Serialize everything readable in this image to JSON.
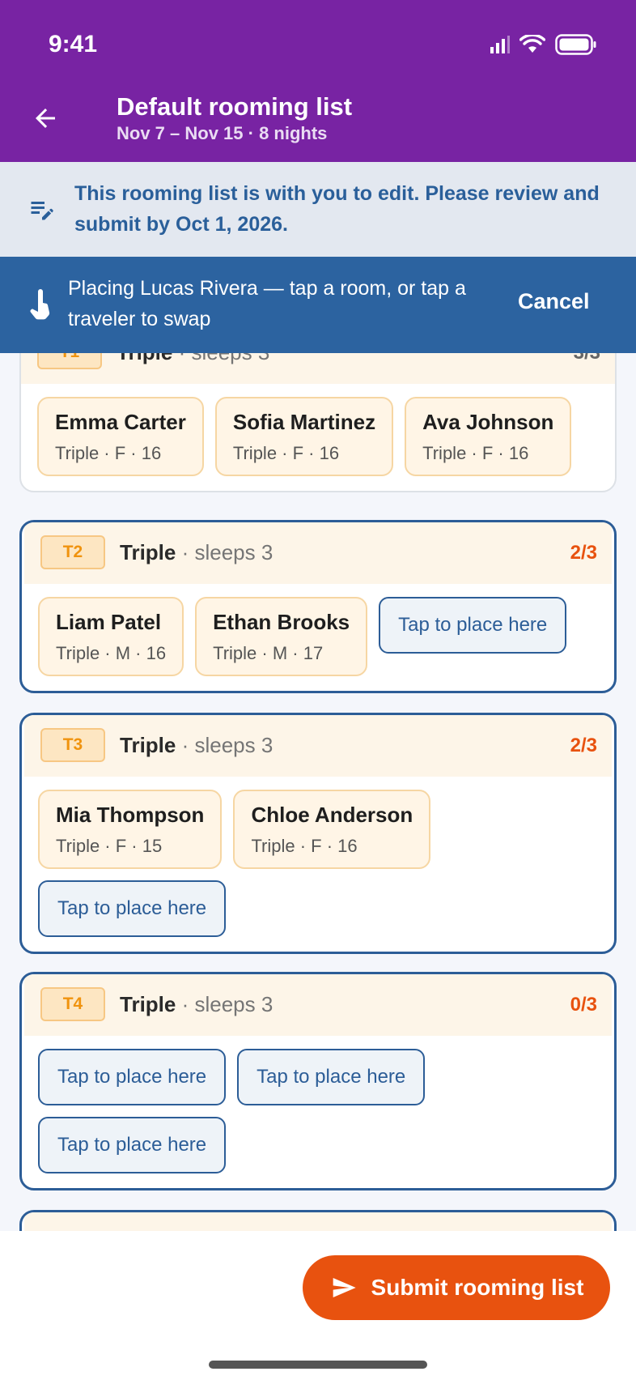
{
  "status": {
    "time": "9:41"
  },
  "header": {
    "title": "Default rooming list",
    "subtitle": "Nov 7 – Nov 15 · 8 nights"
  },
  "info_banner": {
    "text": "This rooming list is with you to edit. Please review and submit by Oct 1, 2026."
  },
  "placing_banner": {
    "text": "Placing Lucas Rivera — tap a room, or tap a traveler to swap",
    "cancel_label": "Cancel"
  },
  "rooms": [
    {
      "code": "T1",
      "type": "Triple",
      "sleeps": "· sleeps 3",
      "count": "3/3",
      "travelers": [
        {
          "name": "Emma Carter",
          "meta": "Triple · F · 16"
        },
        {
          "name": "Sofia Martinez",
          "meta": "Triple · F · 16"
        },
        {
          "name": "Ava Johnson",
          "meta": "Triple · F · 16"
        }
      ]
    },
    {
      "code": "T2",
      "type": "Triple",
      "sleeps": "· sleeps 3",
      "count": "2/3",
      "travelers": [
        {
          "name": "Liam Patel",
          "meta": "Triple · M · 16"
        },
        {
          "name": "Ethan Brooks",
          "meta": "Triple · M · 17"
        }
      ],
      "slot_label": "Tap to place here"
    },
    {
      "code": "T3",
      "type": "Triple",
      "sleeps": "· sleeps 3",
      "count": "2/3",
      "travelers": [
        {
          "name": "Mia Thompson",
          "meta": "Triple · F · 15"
        },
        {
          "name": "Chloe Anderson",
          "meta": "Triple · F · 16"
        }
      ],
      "slot_label": "Tap to place here"
    },
    {
      "code": "T4",
      "type": "Triple",
      "sleeps": "· sleeps 3",
      "count": "0/3",
      "slot_label": "Tap to place here"
    }
  ],
  "submit_label": "Submit rooming list",
  "colors": {
    "brand_purple": "#7823a3",
    "banner_blue": "#2c63a0",
    "accent_orange": "#e8520f",
    "badge_amber": "#f0930e"
  }
}
